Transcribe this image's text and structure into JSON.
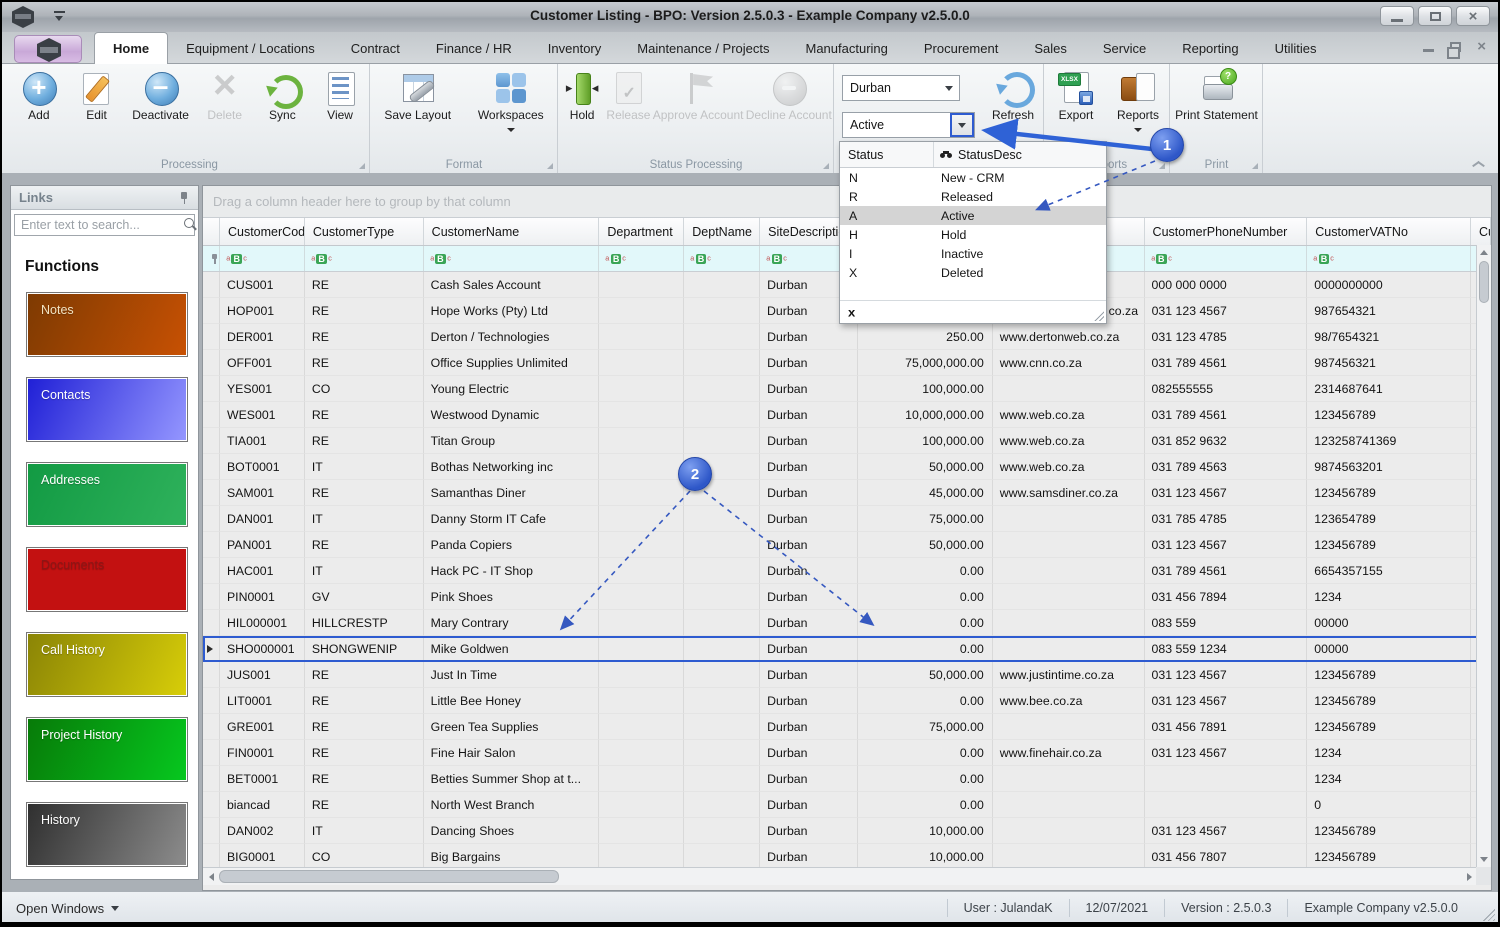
{
  "window": {
    "title": "Customer Listing - BPO: Version 2.5.0.3 - Example Company v2.5.0.0"
  },
  "tabs": {
    "active": "Home",
    "items": [
      "Home",
      "Equipment / Locations",
      "Contract",
      "Finance / HR",
      "Inventory",
      "Maintenance / Projects",
      "Manufacturing",
      "Procurement",
      "Sales",
      "Service",
      "Reporting",
      "Utilities"
    ]
  },
  "ribbon": {
    "groups": [
      {
        "label": "Processing",
        "buttons": [
          {
            "label": "Add",
            "icon": "add-icon",
            "disabled": false
          },
          {
            "label": "Edit",
            "icon": "edit-icon",
            "disabled": false
          },
          {
            "label": "Deactivate",
            "icon": "deactivate-icon",
            "disabled": false
          },
          {
            "label": "Delete",
            "icon": "delete-icon",
            "disabled": true
          },
          {
            "label": "Sync",
            "icon": "sync-icon",
            "disabled": false
          },
          {
            "label": "View",
            "icon": "view-icon",
            "disabled": false
          }
        ]
      },
      {
        "label": "Format",
        "buttons": [
          {
            "label": "Save Layout",
            "icon": "save-layout-icon",
            "disabled": false
          },
          {
            "label": "Workspaces",
            "icon": "workspaces-icon",
            "disabled": false,
            "dropdown": true
          }
        ]
      },
      {
        "label": "Status Processing",
        "buttons": [
          {
            "label": "Hold",
            "icon": "hold-icon",
            "disabled": false
          },
          {
            "label": "Release",
            "icon": "release-icon",
            "disabled": true
          },
          {
            "label": "Approve Account",
            "icon": "approve-account-icon",
            "disabled": true
          },
          {
            "label": "Decline Account",
            "icon": "decline-account-icon",
            "disabled": true
          }
        ]
      },
      {
        "label": "Reports",
        "buttons": [
          {
            "label": "Export",
            "icon": "export-icon",
            "disabled": false
          },
          {
            "label": "Reports",
            "icon": "reports-icon",
            "disabled": false,
            "dropdown": true
          }
        ]
      },
      {
        "label": "Print",
        "buttons": [
          {
            "label": "Print Statement",
            "icon": "print-statement-icon",
            "disabled": false
          }
        ]
      }
    ]
  },
  "filters": {
    "location": "Durban",
    "status": "Active",
    "refresh_label": "Refresh"
  },
  "status_dropdown": {
    "columns": [
      "Status",
      "StatusDesc"
    ],
    "selected": "A",
    "clear_label": "x",
    "rows": [
      {
        "code": "N",
        "desc": "New - CRM"
      },
      {
        "code": "R",
        "desc": "Released"
      },
      {
        "code": "A",
        "desc": "Active"
      },
      {
        "code": "H",
        "desc": "Hold"
      },
      {
        "code": "I",
        "desc": "Inactive"
      },
      {
        "code": "X",
        "desc": "Deleted"
      }
    ]
  },
  "sidebar": {
    "title": "Links",
    "search_placeholder": "Enter text to search...",
    "functions_heading": "Functions",
    "tiles": [
      {
        "label": "Notes",
        "color_from": "#7d3a02",
        "color_to": "#c85103",
        "text_color": "#f2e3c2"
      },
      {
        "label": "Contacts",
        "color_from": "#1f1fd6",
        "color_to": "#9597ff",
        "text_color": "#ffffff"
      },
      {
        "label": "Addresses",
        "color_from": "#129a43",
        "color_to": "#2fb25c",
        "text_color": "#ffffff"
      },
      {
        "label": "Documents",
        "color_from": "#c31111",
        "color_to": "#c31111",
        "text_color": "#8c1616"
      },
      {
        "label": "Call History",
        "color_from": "#8a8406",
        "color_to": "#d8ce08",
        "text_color": "#ffffff"
      },
      {
        "label": "Project History",
        "color_from": "#077a08",
        "color_to": "#06c81f",
        "text_color": "#ffffff"
      },
      {
        "label": "History",
        "color_from": "#2f2f2f",
        "color_to": "#8d8d8d",
        "text_color": "#ffffff"
      }
    ]
  },
  "grid": {
    "group_by_hint": "Drag a column header here to group by that column",
    "columns": [
      {
        "key": "code",
        "label": "CustomerCode"
      },
      {
        "key": "type",
        "label": "CustomerType"
      },
      {
        "key": "name",
        "label": "CustomerName"
      },
      {
        "key": "dept",
        "label": "Department"
      },
      {
        "key": "deptname",
        "label": "DeptName"
      },
      {
        "key": "site",
        "label": "SiteDescription"
      },
      {
        "key": "credit",
        "label": ""
      },
      {
        "key": "web",
        "label": ""
      },
      {
        "key": "phone",
        "label": "CustomerPhoneNumber"
      },
      {
        "key": "vat",
        "label": "CustomerVATNo"
      },
      {
        "key": "cus",
        "label": "Cus"
      }
    ],
    "selected_code": "SHO000001",
    "rows": [
      {
        "code": "CUS001",
        "type": "RE",
        "name": "Cash Sales Account",
        "dept": "",
        "deptname": "",
        "site": "Durban",
        "credit": "",
        "web": "",
        "phone": "000 000 0000",
        "vat": "0000000000"
      },
      {
        "code": "HOP001",
        "type": "RE",
        "name": "Hope Works (Pty) Ltd",
        "dept": "",
        "deptname": "",
        "site": "Durban",
        "credit": "",
        "web": "co.za",
        "phone": "031 123 4567",
        "vat": "987654321"
      },
      {
        "code": "DER001",
        "type": "RE",
        "name": "Derton / Technologies",
        "dept": "",
        "deptname": "",
        "site": "Durban",
        "credit": "250.00",
        "web": "www.dertonweb.co.za",
        "phone": "031 123 4785",
        "vat": "98/7654321"
      },
      {
        "code": "OFF001",
        "type": "RE",
        "name": "Office Supplies Unlimited",
        "dept": "",
        "deptname": "",
        "site": "Durban",
        "credit": "75,000,000.00",
        "web": "www.cnn.co.za",
        "phone": "031 789 4561",
        "vat": "987456321"
      },
      {
        "code": "YES001",
        "type": "CO",
        "name": "Young Electric",
        "dept": "",
        "deptname": "",
        "site": "Durban",
        "credit": "100,000.00",
        "web": "",
        "phone": "082555555",
        "vat": "2314687641"
      },
      {
        "code": "WES001",
        "type": "RE",
        "name": "Westwood Dynamic",
        "dept": "",
        "deptname": "",
        "site": "Durban",
        "credit": "10,000,000.00",
        "web": "www.web.co.za",
        "phone": "031 789 4561",
        "vat": "123456789"
      },
      {
        "code": "TIA001",
        "type": "RE",
        "name": "Titan Group",
        "dept": "",
        "deptname": "",
        "site": "Durban",
        "credit": "100,000.00",
        "web": "www.web.co.za",
        "phone": "031 852 9632",
        "vat": "123258741369"
      },
      {
        "code": "BOT0001",
        "type": "IT",
        "name": "Bothas Networking inc",
        "dept": "",
        "deptname": "",
        "site": "Durban",
        "credit": "50,000.00",
        "web": "www.web.co.za",
        "phone": "031 789 4563",
        "vat": "9874563201"
      },
      {
        "code": "SAM001",
        "type": "RE",
        "name": "Samanthas Diner",
        "dept": "",
        "deptname": "",
        "site": "Durban",
        "credit": "45,000.00",
        "web": "www.samsdiner.co.za",
        "phone": "031 123 4567",
        "vat": "123456789"
      },
      {
        "code": "DAN001",
        "type": "IT",
        "name": "Danny Storm IT Cafe",
        "dept": "",
        "deptname": "",
        "site": "Durban",
        "credit": "75,000.00",
        "web": "",
        "phone": "031 785 4785",
        "vat": "123654789"
      },
      {
        "code": "PAN001",
        "type": "RE",
        "name": "Panda Copiers",
        "dept": "",
        "deptname": "",
        "site": "Durban",
        "credit": "50,000.00",
        "web": "",
        "phone": "031 123 4567",
        "vat": "123456789"
      },
      {
        "code": "HAC001",
        "type": "IT",
        "name": "Hack PC - IT Shop",
        "dept": "",
        "deptname": "",
        "site": "Durban",
        "credit": "0.00",
        "web": "",
        "phone": "031 789 4561",
        "vat": "6654357155"
      },
      {
        "code": "PIN0001",
        "type": "GV",
        "name": "Pink Shoes",
        "dept": "",
        "deptname": "",
        "site": "Durban",
        "credit": "0.00",
        "web": "",
        "phone": "031 456 7894",
        "vat": "1234"
      },
      {
        "code": "HIL000001",
        "type": "HILLCRESTP",
        "name": "Mary Contrary",
        "dept": "",
        "deptname": "",
        "site": "Durban",
        "credit": "0.00",
        "web": "",
        "phone": "083 559",
        "vat": "00000"
      },
      {
        "code": "SHO000001",
        "type": "SHONGWENIP",
        "name": "Mike Goldwen",
        "dept": "",
        "deptname": "",
        "site": "Durban",
        "credit": "0.00",
        "web": "",
        "phone": "083 559 1234",
        "vat": "00000"
      },
      {
        "code": "JUS001",
        "type": "RE",
        "name": "Just In Time",
        "dept": "",
        "deptname": "",
        "site": "Durban",
        "credit": "50,000.00",
        "web": "www.justintime.co.za",
        "phone": "031 123 4567",
        "vat": "123456789"
      },
      {
        "code": "LIT0001",
        "type": "RE",
        "name": "Little Bee Honey",
        "dept": "",
        "deptname": "",
        "site": "Durban",
        "credit": "0.00",
        "web": "www.bee.co.za",
        "phone": "031 123 4567",
        "vat": "123456789"
      },
      {
        "code": "GRE001",
        "type": "RE",
        "name": "Green Tea Supplies",
        "dept": "",
        "deptname": "",
        "site": "Durban",
        "credit": "75,000.00",
        "web": "",
        "phone": "031 456 7891",
        "vat": "123456789"
      },
      {
        "code": "FIN0001",
        "type": "RE",
        "name": "Fine Hair Salon",
        "dept": "",
        "deptname": "",
        "site": "Durban",
        "credit": "0.00",
        "web": "www.finehair.co.za",
        "phone": "031 123 4567",
        "vat": "1234"
      },
      {
        "code": "BET0001",
        "type": "RE",
        "name": "Betties Summer Shop at t...",
        "dept": "",
        "deptname": "",
        "site": "Durban",
        "credit": "0.00",
        "web": "",
        "phone": "",
        "vat": "1234"
      },
      {
        "code": "biancad",
        "type": "RE",
        "name": "North West Branch",
        "dept": "",
        "deptname": "",
        "site": "Durban",
        "credit": "0.00",
        "web": "",
        "phone": "",
        "vat": "0"
      },
      {
        "code": "DAN002",
        "type": "IT",
        "name": "Dancing Shoes",
        "dept": "",
        "deptname": "",
        "site": "Durban",
        "credit": "10,000.00",
        "web": "",
        "phone": "031 123 4567",
        "vat": "123456789"
      },
      {
        "code": "BIG0001",
        "type": "CO",
        "name": "Big Bargains",
        "dept": "",
        "deptname": "",
        "site": "Durban",
        "credit": "10,000.00",
        "web": "",
        "phone": "031 456 7807",
        "vat": "123456789"
      }
    ]
  },
  "statusbar": {
    "open_windows": "Open Windows",
    "user": "User : JulandaK",
    "date": "12/07/2021",
    "version": "Version : 2.5.0.3",
    "company": "Example Company v2.5.0.0"
  },
  "callouts": {
    "one": "1",
    "two": "2"
  }
}
